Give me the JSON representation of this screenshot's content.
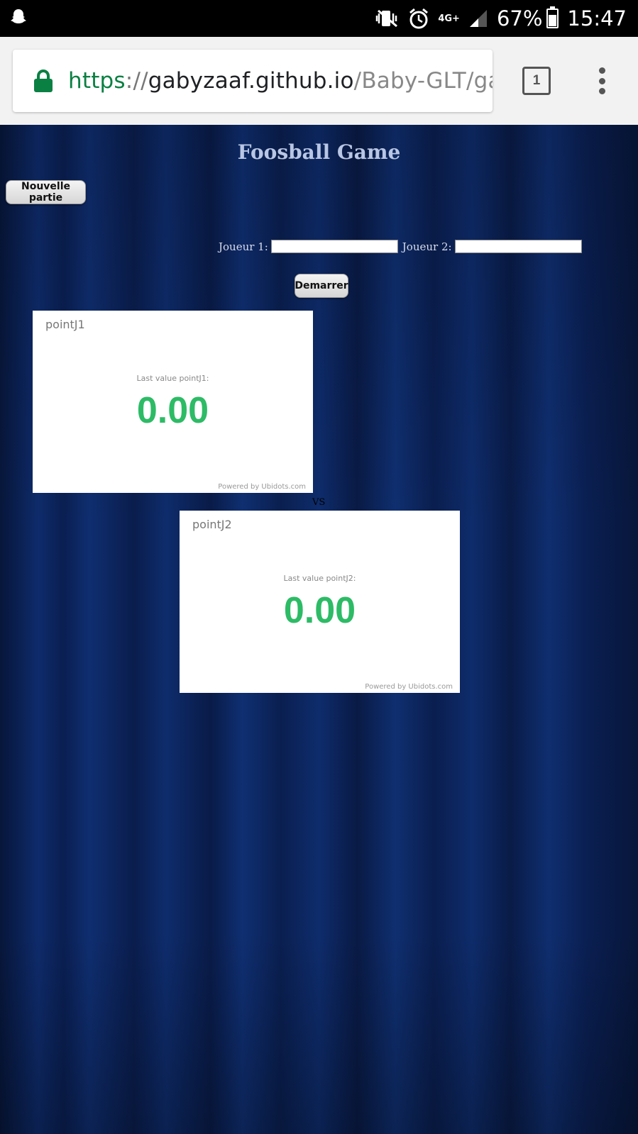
{
  "status_bar": {
    "network": "4G+",
    "battery_text": "67%",
    "battery_level": 0.67,
    "clock": "15:47",
    "icons": [
      "snapchat-ghost-icon",
      "vibrate-mute-icon",
      "alarm-icon",
      "signal-icon",
      "battery-icon"
    ]
  },
  "browser": {
    "url_scheme": "https",
    "url_sep": "://",
    "url_host": "gabyzaaf.github.io",
    "url_path": "/Baby-GLT/gam",
    "tab_count": "1",
    "accent_color": "#0b8043"
  },
  "page": {
    "title": "Foosball Game",
    "new_game_label": "Nouvelle partie",
    "player1_label": "Joueur 1:",
    "player2_label": "Joueur 2:",
    "player1_value": "",
    "player2_value": "",
    "start_label": "Demarrer",
    "vs_label": "VS"
  },
  "widgets": [
    {
      "title": "pointJ1",
      "caption": "Last value pointJ1:",
      "value": "0.00",
      "footer": "Powered by Ubidots.com"
    },
    {
      "title": "pointJ2",
      "caption": "Last value pointJ2:",
      "value": "0.00",
      "footer": "Powered by Ubidots.com"
    }
  ],
  "colors": {
    "value_green": "#2dbb66",
    "page_background": "#0e2b6b"
  }
}
